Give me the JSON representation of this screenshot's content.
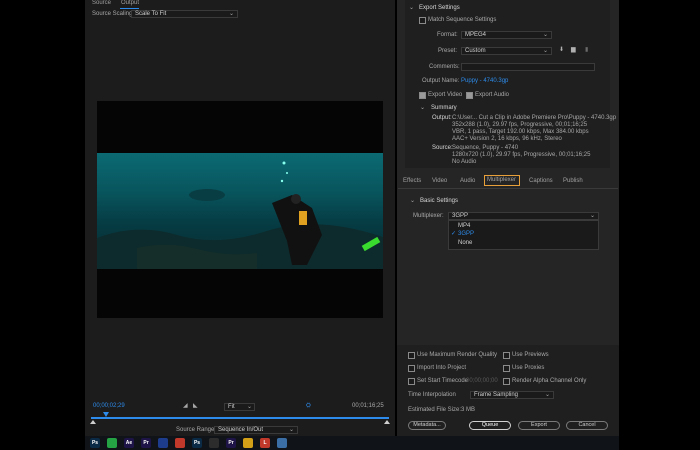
{
  "source_panel": {
    "tabs": [
      "Source",
      "Output"
    ],
    "active_tab": "Output",
    "scaling_label": "Source Scaling",
    "scaling_value": "Scale To Fit"
  },
  "timeline": {
    "current_time": "00;00;02;29",
    "fit_value": "Fit",
    "end_time": "00;01;16;25",
    "source_range_label": "Source Range",
    "source_range_value": "Sequence In/Out",
    "playhead_fraction": 0.05
  },
  "export_settings": {
    "header": "Export Settings",
    "match_sequence": "Match Sequence Settings",
    "format_label": "Format:",
    "format_value": "MPEG4",
    "preset_label": "Preset:",
    "preset_value": "Custom",
    "comments_label": "Comments:",
    "output_name_label": "Output Name:",
    "output_name_value": "Puppy - 4740.3gp",
    "export_video": "Export Video",
    "export_audio": "Export Audio"
  },
  "summary": {
    "header": "Summary",
    "output_label": "Output:",
    "output_lines": [
      "C:\\User... Cut a Clip in Adobe Premiere Pro\\Puppy - 4740.3gp",
      "352x288 (1.0), 29.97 fps, Progressive, 00;01;16;25",
      "VBR, 1 pass, Target 192.00 kbps, Max 384.00 kbps",
      "AAC+ Version 2, 16 kbps, 96 kHz, Stereo"
    ],
    "source_label": "Source:",
    "source_lines": [
      "Sequence, Puppy - 4740",
      "1280x720 (1.0), 29.97 fps, Progressive, 00;01;16;25",
      "No Audio"
    ]
  },
  "tabs": [
    "Effects",
    "Video",
    "Audio",
    "Multiplexer",
    "Captions",
    "Publish"
  ],
  "active_tab": "Multiplexer",
  "basic_settings": {
    "header": "Basic Settings",
    "multiplexer_label": "Multiplexer:",
    "multiplexer_value": "3GPP",
    "options": [
      "MP4",
      "3GPP",
      "None"
    ],
    "selected_option": "3GPP"
  },
  "render_options": {
    "max_render_quality": "Use Maximum Render Quality",
    "use_previews": "Use Previews",
    "import_into_project": "Import Into Project",
    "use_proxies": "Use Proxies",
    "set_start_timecode": "Set Start Timecode",
    "timecode_value": "00;00;00;00",
    "render_alpha": "Render Alpha Channel Only",
    "time_interp_label": "Time Interpolation",
    "time_interp_value": "Frame Sampling",
    "file_size_label": "Estimated File Size:",
    "file_size_value": "3 MB"
  },
  "buttons": {
    "metadata": "Metadata...",
    "queue": "Queue",
    "export": "Export",
    "cancel": "Cancel"
  },
  "taskbar": {
    "icons": [
      {
        "name": "ps",
        "label": "Ps",
        "color": "#0b2a45"
      },
      {
        "name": "whatsapp",
        "label": "",
        "color": "#25a244"
      },
      {
        "name": "ae",
        "label": "Ae",
        "color": "#1f1447"
      },
      {
        "name": "pr",
        "label": "Pr",
        "color": "#1f1447"
      },
      {
        "name": "app5",
        "label": "",
        "color": "#1e3c8c"
      },
      {
        "name": "app6",
        "label": "",
        "color": "#c0392b"
      },
      {
        "name": "ps2",
        "label": "Ps",
        "color": "#0b2a45"
      },
      {
        "name": "app8",
        "label": "",
        "color": "#2c2c2c"
      },
      {
        "name": "pr2",
        "label": "Pr",
        "color": "#1f1447"
      },
      {
        "name": "app10",
        "label": "",
        "color": "#d4a017"
      },
      {
        "name": "app11",
        "label": "L",
        "color": "#c0392b"
      },
      {
        "name": "app12",
        "label": "",
        "color": "#3a6ea5"
      }
    ]
  }
}
